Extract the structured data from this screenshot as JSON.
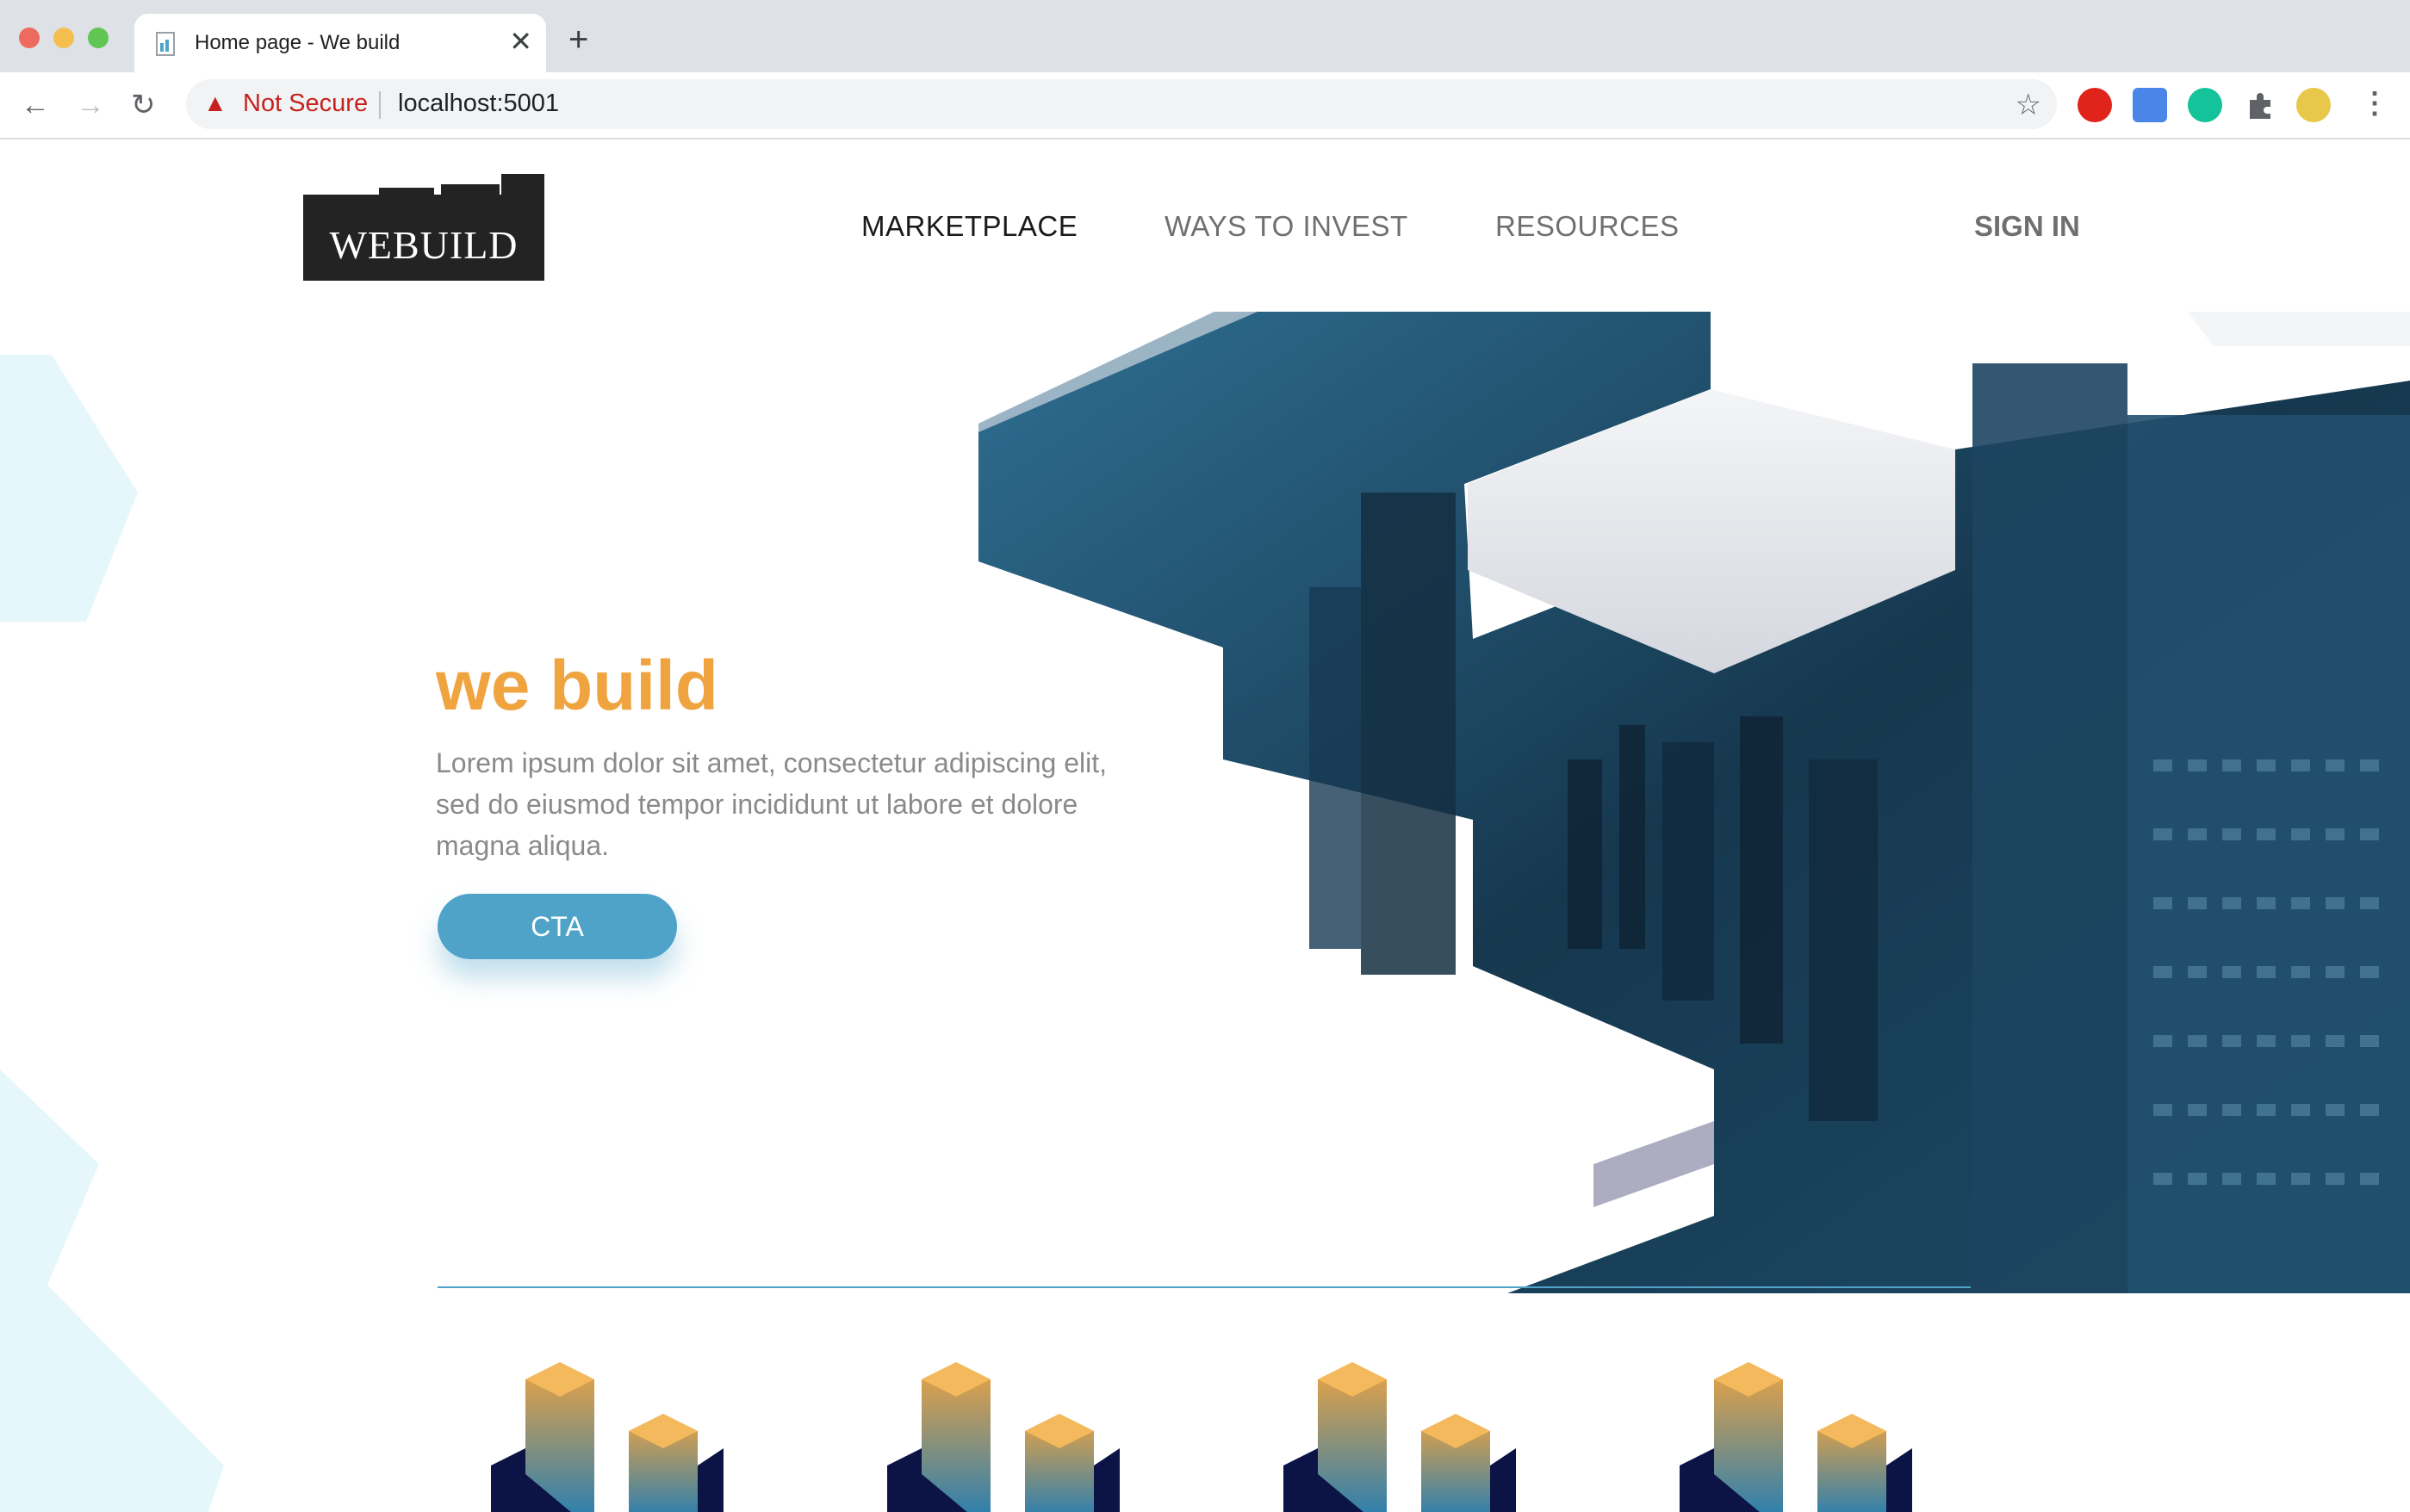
{
  "browser": {
    "tab_title": "Home page - We build",
    "tab_close": "✕",
    "new_tab": "+",
    "security_label": "Not Secure",
    "url": "localhost:5001",
    "back": "←",
    "forward": "→",
    "reload": "↻",
    "star": "☆",
    "menu": "⋮",
    "warning_icon": "▲"
  },
  "nav": {
    "logo": "WEBUILD",
    "items": [
      {
        "label": "MARKETPLACE",
        "active": true
      },
      {
        "label": "WAYS TO INVEST",
        "active": false
      },
      {
        "label": "RESOURCES",
        "active": false
      }
    ],
    "signin": "SIGN IN"
  },
  "hero": {
    "title": "we build",
    "text": "Lorem ipsum dolor sit amet, consectetur adipiscing elit, sed do eiusmod tempor incididunt ut labore et dolore magna aliqua.",
    "cta": "CTA"
  },
  "colors": {
    "accent": "#f0a440",
    "primary": "#4fa3c9",
    "dark": "#232323"
  }
}
